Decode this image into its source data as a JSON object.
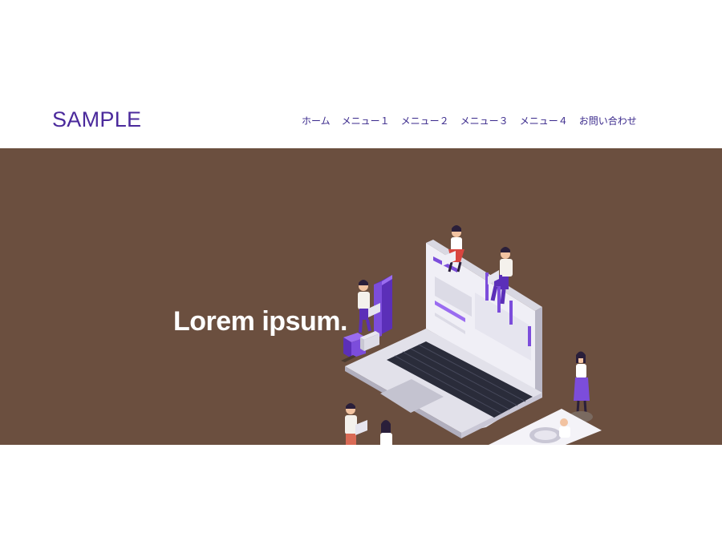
{
  "header": {
    "logo": "SAMPLE",
    "nav": [
      "ホーム",
      "メニュー１",
      "メニュー２",
      "メニュー３",
      "メニュー４",
      "お問い合わせ"
    ]
  },
  "hero": {
    "title": "Lorem ipsum.",
    "illustration": "isometric-laptop-people-illustration"
  },
  "colors": {
    "brand": "#4b2a9c",
    "hero_bg": "#6b4f3f",
    "accent_purple": "#7c4ddb"
  }
}
